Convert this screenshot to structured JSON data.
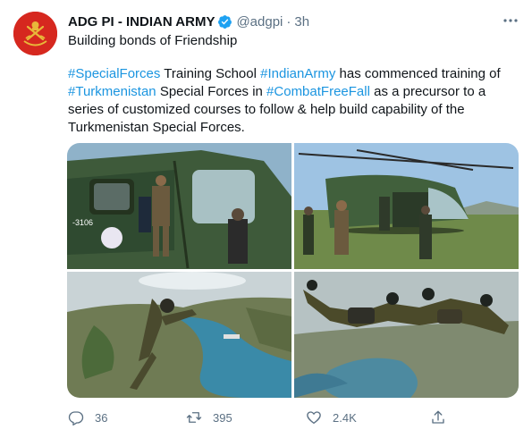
{
  "tweet": {
    "author_name": "ADG PI - INDIAN ARMY",
    "handle": "@adgpi",
    "separator": "·",
    "time": "3h",
    "subtitle": "Building bonds of Friendship",
    "body": {
      "hashtag_special_forces": "#SpecialForces",
      "text_1": " Training School ",
      "hashtag_indian_army": "#IndianArmy",
      "text_2": " has commenced training of",
      "hashtag_turkmenistan": "#Turkmenistan",
      "text_3": " Special Forces in ",
      "hashtag_combat_free_fall": "#CombatFreeFall",
      "text_4": " as a precursor to a series of customized courses to follow & help build capability of the Turkmenistan Special Forces."
    },
    "actions": {
      "reply_count": "36",
      "retweet_count": "395",
      "like_count": "2.4K"
    }
  },
  "icons": {
    "avatar": "indian-army-emblem",
    "verified": "verified-badge-icon",
    "more": "more-dots-icon",
    "reply": "reply-icon",
    "retweet": "retweet-icon",
    "like": "heart-icon",
    "share": "share-icon"
  },
  "colors": {
    "hashtag": "#1b95e0",
    "secondary_text": "#5b7083",
    "verified": "#1da1f2",
    "avatar_red": "#d6281f"
  }
}
